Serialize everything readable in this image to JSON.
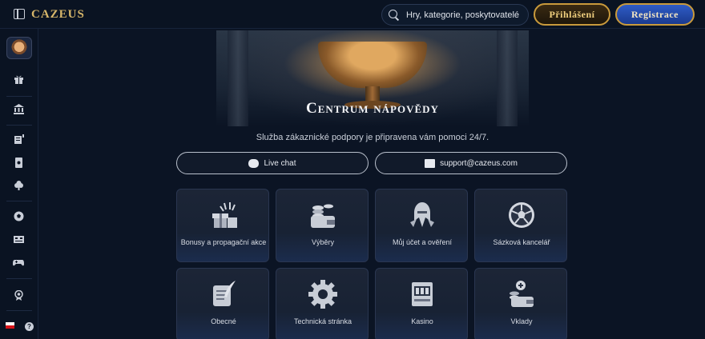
{
  "header": {
    "logo": "CAZEUS",
    "search_placeholder": "Hry, kategorie, poskytovatelé",
    "login_label": "Přihlášení",
    "register_label": "Registrace"
  },
  "sidebar": {
    "icons": [
      "avatar-icon",
      "gift-icon",
      "bank-icon",
      "tickets-icon",
      "cards-icon",
      "chip-icon",
      "soccer-icon",
      "scoreboard-icon",
      "gamepad-icon",
      "badge-icon"
    ],
    "language_flag": "cz-flag-icon",
    "help_icon": "help-icon"
  },
  "hero": {
    "title": "Centrum nápovědy",
    "subtitle": "Služba zákaznické podpory je připravena vám pomoci 24/7."
  },
  "contacts": {
    "live_chat": "Live chat",
    "email": "support@cazeus.com"
  },
  "categories": [
    {
      "label": "Bonusy a propagační akce",
      "icon": "gift-box-icon"
    },
    {
      "label": "Výběry",
      "icon": "coins-wallet-icon"
    },
    {
      "label": "Můj účet a ověření",
      "icon": "warrior-helmet-icon"
    },
    {
      "label": "Sázková kancelář",
      "icon": "soccer-ball-icon"
    },
    {
      "label": "Obecné",
      "icon": "scroll-quill-icon"
    },
    {
      "label": "Technická stránka",
      "icon": "gear-icon"
    },
    {
      "label": "Kasino",
      "icon": "slot-machine-icon"
    },
    {
      "label": "Vklady",
      "icon": "deposit-wallet-icon"
    }
  ],
  "colors": {
    "background": "#0b1424",
    "gold": "#c99a3c",
    "register_blue": "#2f5cc6"
  }
}
